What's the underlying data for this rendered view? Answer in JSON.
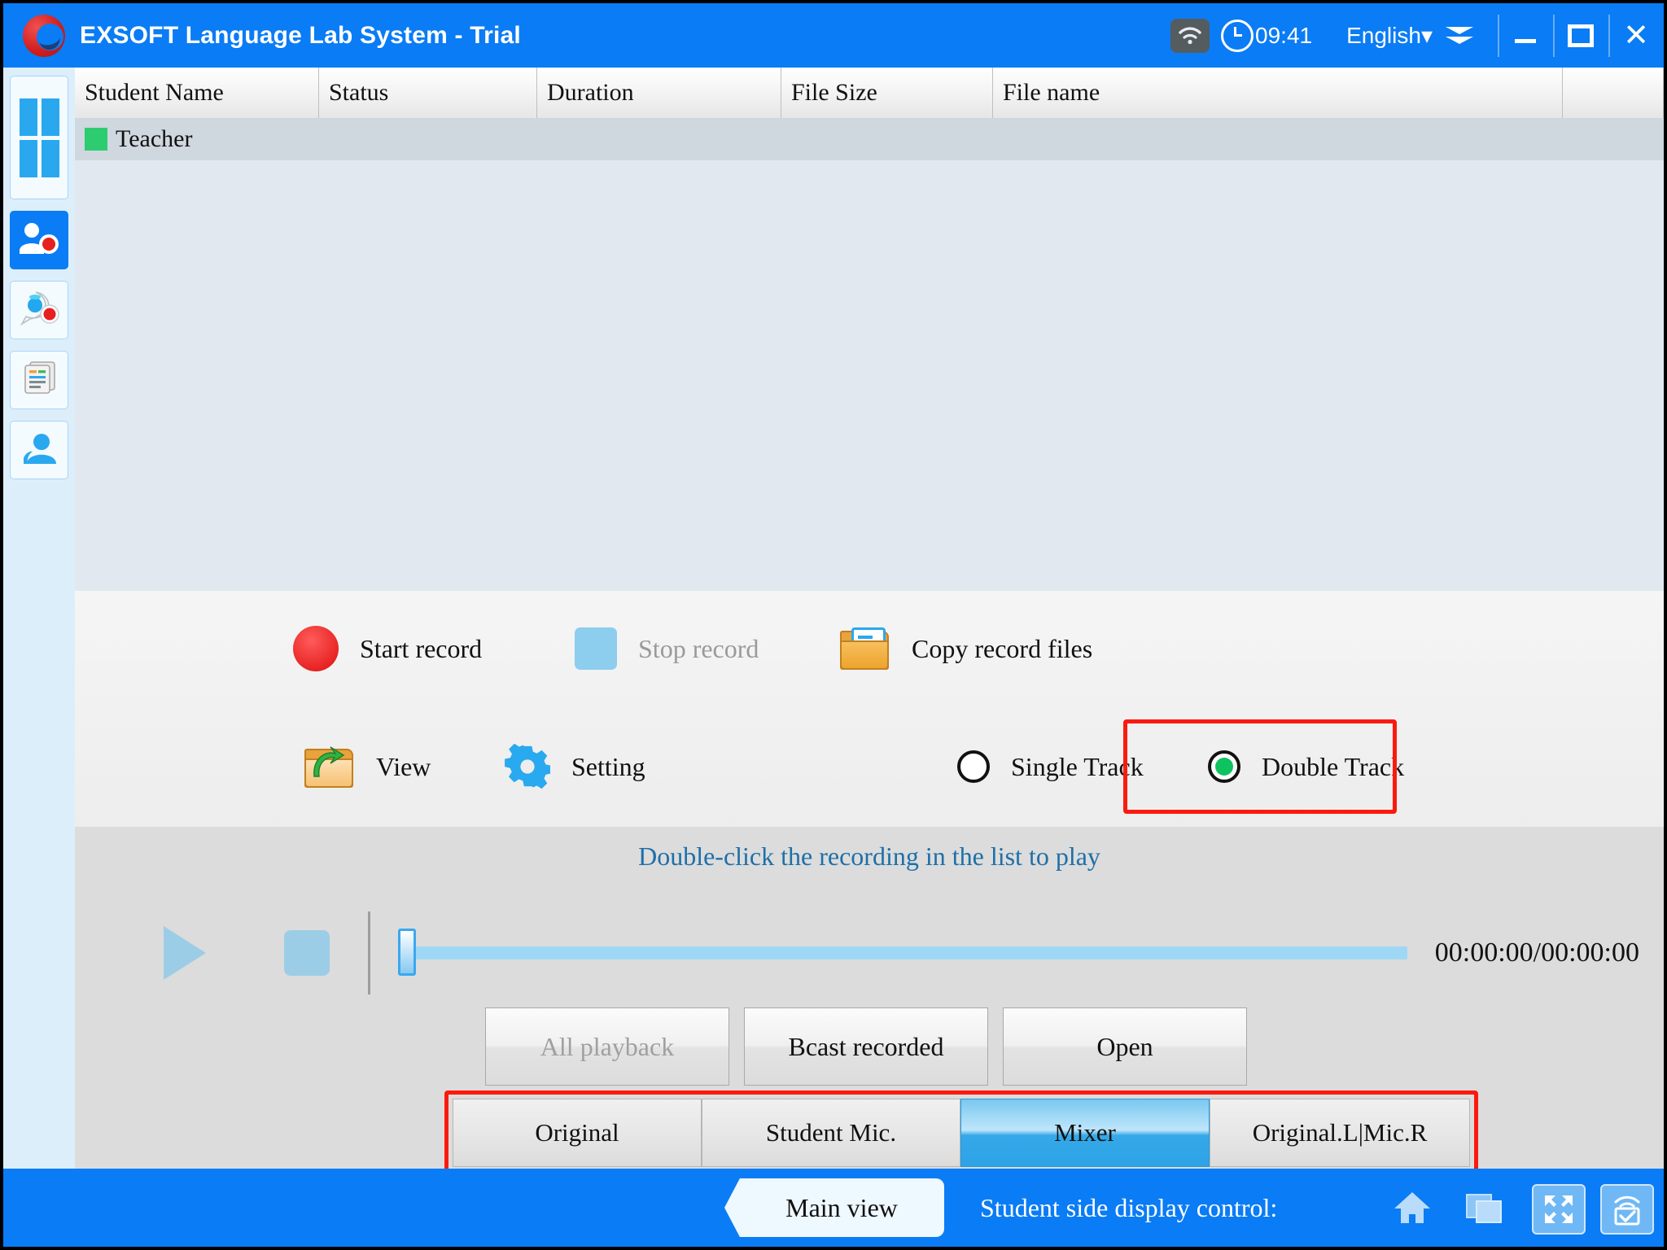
{
  "window": {
    "title": "EXSOFT Language Lab System - Trial",
    "logo_icon": "exsoft-logo-icon",
    "wifi_icon": "wifi-icon",
    "clock_icon": "clock-icon",
    "time": "09:41",
    "language": "English▾",
    "collapse_icon": "double-chevron-down-icon",
    "minimize_icon": "minimize-icon",
    "maximize_icon": "maximize-icon",
    "close_icon": "close-icon",
    "accent_color": "#0a7cf5"
  },
  "sidebar": {
    "items": [
      {
        "name": "layout-grid",
        "icon": "grid-icon",
        "selected": false
      },
      {
        "name": "student-record",
        "icon": "person-record-icon",
        "selected": true
      },
      {
        "name": "voice-record",
        "icon": "speech-bubble-record-icon",
        "selected": false
      },
      {
        "name": "documents",
        "icon": "documents-icon",
        "selected": false
      },
      {
        "name": "user-profile",
        "icon": "user-icon",
        "selected": false
      }
    ]
  },
  "table": {
    "columns": [
      "Student Name",
      "Status",
      "Duration",
      "File Size",
      "File name"
    ],
    "rows": [
      {
        "student_name": "Teacher",
        "status_color": "#2ecc71",
        "status": "",
        "duration": "",
        "file_size": "",
        "file_name": ""
      }
    ]
  },
  "controls": {
    "start_record": {
      "label": "Start record",
      "icon": "record-circle-icon",
      "enabled": true
    },
    "stop_record": {
      "label": "Stop record",
      "icon": "stop-square-icon",
      "enabled": false
    },
    "copy_record_files": {
      "label": "Copy record files",
      "icon": "folder-document-icon"
    },
    "view": {
      "label": "View",
      "icon": "folder-open-arrow-icon"
    },
    "setting": {
      "label": "Setting",
      "icon": "gear-icon"
    },
    "single_track": {
      "label": "Single Track",
      "icon": "radio-unselected-icon",
      "selected": false
    },
    "double_track": {
      "label": "Double Track",
      "icon": "radio-selected-icon",
      "selected": true,
      "highlight_color": "#fa1a0f"
    }
  },
  "player": {
    "hint": "Double-click the recording in the list to play",
    "play_icon": "play-icon",
    "stop_icon": "stop-icon",
    "progress_percent": 0,
    "timecode": "00:00:00/00:00:00",
    "buttons": [
      {
        "label": "All playback",
        "enabled": false
      },
      {
        "label": "Bcast recorded",
        "enabled": true
      },
      {
        "label": "Open",
        "enabled": true
      }
    ],
    "tracks": [
      {
        "label": "Original",
        "selected": false
      },
      {
        "label": "Student Mic.",
        "selected": false
      },
      {
        "label": "Mixer",
        "selected": true
      },
      {
        "label": "Original.L|Mic.R",
        "selected": false
      }
    ],
    "tracks_highlight_color": "#fa1a0f"
  },
  "bottom": {
    "main_view": "Main view",
    "display_control_label": "Student side display control:",
    "icons": [
      {
        "name": "home-icon",
        "boxed": false
      },
      {
        "name": "windows-cascade-icon",
        "boxed": false
      },
      {
        "name": "fullscreen-expand-icon",
        "boxed": true
      },
      {
        "name": "broadcast-screen-icon",
        "boxed": true
      }
    ]
  }
}
